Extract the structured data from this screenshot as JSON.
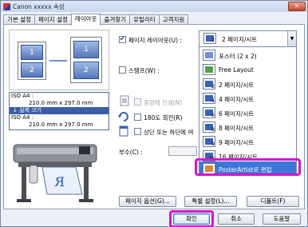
{
  "window": {
    "title": "Canon xxxxx 속성",
    "close_label": "✕"
  },
  "tabs": [
    {
      "label": "기본 설정",
      "active": false
    },
    {
      "label": "페이지 설정",
      "active": false
    },
    {
      "label": "레이아웃",
      "active": true
    },
    {
      "label": "즐겨찾기",
      "active": false
    },
    {
      "label": "유틸리티",
      "active": false
    },
    {
      "label": "고객지원",
      "active": false
    }
  ],
  "preview": {
    "page_numbers": [
      "1",
      "2"
    ],
    "info": {
      "line1": "ISO A4 :",
      "line2": "210.0 mm x 297.0 mm",
      "bar": "↓  실제 크기",
      "line3": "ISO A4 :",
      "line4": "210.0 mm x 297.0 mm"
    },
    "print_letter": "R"
  },
  "layout": {
    "page_layout_label": "페이지 레이아웃(U) :",
    "page_layout_checked": true,
    "selected_value": "2 페이지/시트",
    "selected_icon_number": "2",
    "staple_label": "스탬프(W) :",
    "options": [
      {
        "label": "중앙에 인쇄(N)",
        "disabled": true
      },
      {
        "label": "180도 회전(R)",
        "disabled": false
      },
      {
        "label": "상단 또는 하단에 여",
        "disabled": false
      }
    ],
    "copies_label": "부수(C) :"
  },
  "dropdown": {
    "items": [
      {
        "label": "포스터 (2 x 2)",
        "icon": "poster-icon",
        "num": ""
      },
      {
        "label": "Free Layout",
        "icon": "free-layout-icon",
        "num": ""
      },
      {
        "label": "2 페이지/시트",
        "icon": "two-pages-icon",
        "num": "2"
      },
      {
        "label": "4 페이지/시트",
        "icon": "four-pages-icon",
        "num": "4"
      },
      {
        "label": "6 페이지/시트",
        "icon": "six-pages-icon",
        "num": "6"
      },
      {
        "label": "8 페이지/시트",
        "icon": "eight-pages-icon",
        "num": "8"
      },
      {
        "label": "9 페이지/시트",
        "icon": "nine-pages-icon",
        "num": "9"
      },
      {
        "label": "16 페이지/시트",
        "icon": "sixteen-pages-icon",
        "num": "16"
      },
      {
        "label": "PosterArtist로 편집",
        "icon": "posterartist-icon",
        "num": ""
      }
    ],
    "selected_index": 8
  },
  "buttons": {
    "page_options": "페이지 옵션(G)...",
    "special_settings": "특별 설정(L)...",
    "defaults": "디폴트(F)",
    "ok": "확인",
    "cancel": "취소",
    "help": "도움말"
  },
  "colors": {
    "accent": "#3d78d8",
    "highlight": "#d417c9",
    "page_icon": "#3a63b5"
  }
}
